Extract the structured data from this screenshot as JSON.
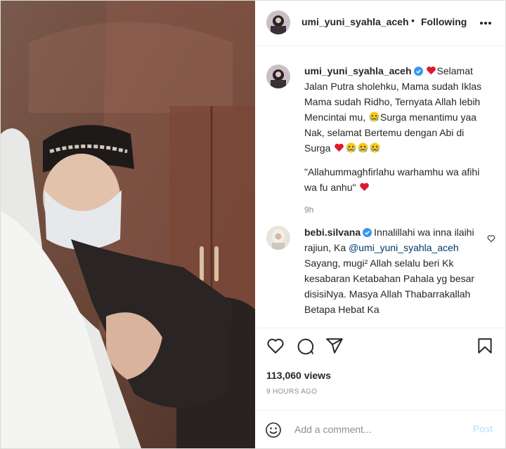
{
  "colors": {
    "accent": "#0095f6",
    "verified": "#3897f0",
    "heart": "#ed4956",
    "muted": "#8e8e8e",
    "mention": "#00376b",
    "post_disabled": "#b2dffc"
  },
  "header": {
    "username": "umi_yuni_syahla_aceh",
    "separator": "•",
    "follow_label": "Following",
    "more_icon": "more-horizontal-icon"
  },
  "caption": {
    "username": "umi_yuni_syahla_aceh",
    "text_1": "Selamat Jalan Putra sholehku, Mama sudah Iklas Mama sudah Ridho, Ternyata Allah lebih Mencintai mu,",
    "text_2": "Surga menantimu yaa Nak, selamat Bertemu dengan Abi di Surga",
    "quote": "\"Allahummaghfirlahu warhamhu wa afihi wa fu anhu\"",
    "time": "9h"
  },
  "comment": {
    "username": "bebi.silvana",
    "text_1": "Innalillahi wa inna ilaihi rajiun, Ka",
    "mention": "@umi_yuni_syahla_aceh",
    "text_2": "Sayang, mugi² Allah selalu beri Kk kesabaran Ketabahan Pahala yg besar disisiNya. Masya Allah Thabarrakallah Betapa Hebat Ka"
  },
  "actions": {
    "icons": [
      "heart-icon",
      "comment-icon",
      "share-icon",
      "bookmark-icon"
    ]
  },
  "stats": {
    "views": "113,060 views",
    "posted": "9 HOURS AGO"
  },
  "add_comment": {
    "placeholder": "Add a comment...",
    "post_label": "Post"
  }
}
